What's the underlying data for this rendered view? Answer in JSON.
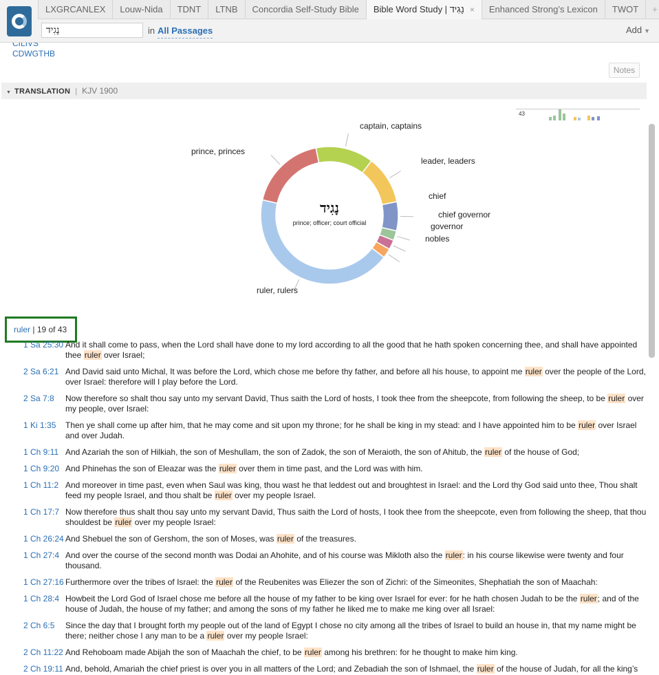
{
  "tabs": [
    {
      "label": "LXGRCANLEX"
    },
    {
      "label": "Louw-Nida"
    },
    {
      "label": "TDNT"
    },
    {
      "label": "LTNB"
    },
    {
      "label": "Concordia Self-Study Bible"
    },
    {
      "label": "Bible Word Study | נָגִיד",
      "active": true
    },
    {
      "label": "Enhanced Strong’s Lexicon"
    },
    {
      "label": "TWOT"
    }
  ],
  "tab_plus": "+",
  "tab_close": "×",
  "search": {
    "value": "נָגִיד",
    "in_label": "in",
    "scope": "All Passages"
  },
  "add_label": "Add",
  "links": {
    "cut_link": "CILIVS",
    "cdwgthb": "CDWGTHB"
  },
  "notes_label": "Notes",
  "section": {
    "label": "TRANSLATION",
    "separator": "|",
    "version": "KJV 1900"
  },
  "minichart_label": "43",
  "chart_data": {
    "type": "pie",
    "title": "נָגִיד",
    "subtitle": "prince; officer; court official",
    "slices": [
      {
        "label": "captain, captains",
        "value": 6,
        "color": "#b5d150"
      },
      {
        "label": "leader, leaders",
        "value": 5,
        "color": "#f3c65c"
      },
      {
        "label": "chief",
        "value": 3,
        "color": "#8094c8"
      },
      {
        "label": "chief governor",
        "value": 1,
        "color": "#9cc59a"
      },
      {
        "label": "governor",
        "value": 1,
        "color": "#c97295"
      },
      {
        "label": "nobles",
        "value": 1,
        "color": "#f6a65f"
      },
      {
        "label": "ruler, rulers",
        "value": 19,
        "color": "#a9c9ec"
      },
      {
        "label": "prince, princes",
        "value": 8,
        "color": "#d47471"
      }
    ]
  },
  "badge": {
    "word": "ruler",
    "sep": "|",
    "count": "19 of 43"
  },
  "verses": [
    {
      "ref": "1 Sa 25:30",
      "pre": "And it shall come to pass, when the Lord shall have done to my lord according to all the good that he hath spoken concerning thee, and shall have appointed thee ",
      "hl": "ruler",
      "post": " over Israel;"
    },
    {
      "ref": "2 Sa 6:21",
      "pre": "And David said unto Michal, It was before the Lord, which chose me before thy father, and before all his house, to appoint me ",
      "hl": "ruler",
      "post": " over the people of the Lord, over Israel: therefore will I play before the Lord."
    },
    {
      "ref": "2 Sa 7:8",
      "pre": "Now therefore so shalt thou say unto my servant David, Thus saith the Lord of hosts, I took thee from the sheepcote, from following the sheep, to be ",
      "hl": "ruler",
      "post": " over my people, over Israel:"
    },
    {
      "ref": "1 Ki 1:35",
      "pre": "Then ye shall come up after him, that he may come and sit upon my throne; for he shall be king in my stead: and I have appointed him to be ",
      "hl": "ruler",
      "post": " over Israel and over Judah."
    },
    {
      "ref": "1 Ch 9:11",
      "pre": "And Azariah the son of Hilkiah, the son of Meshullam, the son of Zadok, the son of Meraioth, the son of Ahitub, the ",
      "hl": "ruler",
      "post": " of the house of God;"
    },
    {
      "ref": "1 Ch 9:20",
      "pre": "And Phinehas the son of Eleazar was the ",
      "hl": "ruler",
      "post": " over them in time past, and the Lord was with him."
    },
    {
      "ref": "1 Ch 11:2",
      "pre": "And moreover in time past, even when Saul was king, thou wast he that leddest out and broughtest in Israel: and the Lord thy God said unto thee, Thou shalt feed my people Israel, and thou shalt be ",
      "hl": "ruler",
      "post": " over my people Israel."
    },
    {
      "ref": "1 Ch 17:7",
      "pre": "Now therefore thus shalt thou say unto my servant David, Thus saith the Lord of hosts, I took thee from the sheepcote, even from following the sheep, that thou shouldest be ",
      "hl": "ruler",
      "post": " over my people Israel:"
    },
    {
      "ref": "1 Ch 26:24",
      "pre": "And Shebuel the son of Gershom, the son of Moses, was ",
      "hl": "ruler",
      "post": " of the treasures."
    },
    {
      "ref": "1 Ch 27:4",
      "pre": "And over the course of the second month was Dodai an Ahohite, and of his course was Mikloth also the ",
      "hl": "ruler",
      "post": ": in his course likewise were twenty and four thousand."
    },
    {
      "ref": "1 Ch 27:16",
      "pre": "Furthermore over the tribes of Israel: the ",
      "hl": "ruler",
      "post": " of the Reubenites was Eliezer the son of Zichri: of the Simeonites, Shephatiah the son of Maachah:"
    },
    {
      "ref": "1 Ch 28:4",
      "pre": "Howbeit the Lord God of Israel chose me before all the house of my father to be king over Israel for ever: for he hath chosen Judah to be the ",
      "hl": "ruler",
      "post": "; and of the house of Judah, the house of my father; and among the sons of my father he liked me to make me king over all Israel:"
    },
    {
      "ref": "2 Ch 6:5",
      "pre": "Since the day that I brought forth my people out of the land of Egypt I chose no city among all the tribes of Israel to build an house in, that my name might be there; neither chose I any man to be a ",
      "hl": "ruler",
      "post": " over my people Israel:"
    },
    {
      "ref": "2 Ch 11:22",
      "pre": "And Rehoboam made Abijah the son of Maachah the chief, to be ",
      "hl": "ruler",
      "post": " among his brethren: for he thought to make him king."
    },
    {
      "ref": "2 Ch 19:11",
      "pre": "And, behold, Amariah the chief priest is over you in all matters of the Lord; and Zebadiah the son of Ishmael, the ",
      "hl": "ruler",
      "post": " of the house of Judah, for all the king’s matters: also the Levites shall be officers before you."
    }
  ]
}
